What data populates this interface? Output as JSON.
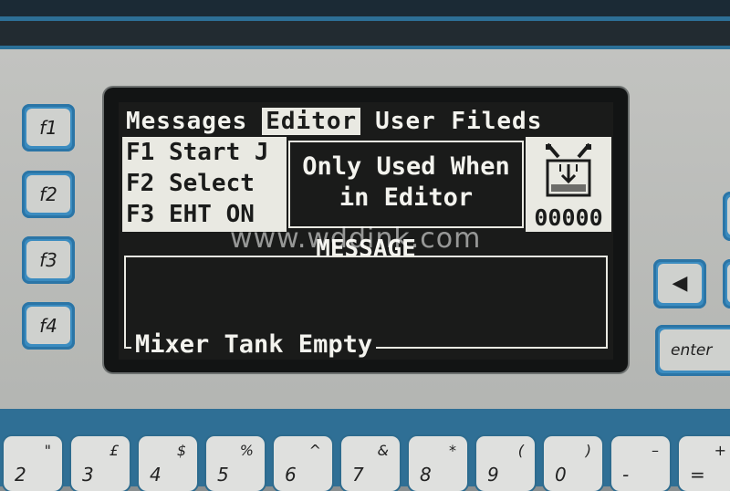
{
  "function_keys": [
    "f1",
    "f2",
    "f3",
    "f4"
  ],
  "screen": {
    "menu": [
      {
        "label": "Messages",
        "selected": false
      },
      {
        "label": "Editor",
        "selected": true
      },
      {
        "label": "User Fileds",
        "selected": false
      }
    ],
    "fkey_items": [
      "F1 Start J",
      "F2 Select",
      "F3 EHT ON"
    ],
    "popup": {
      "line1": "Only Used When",
      "line2": "in Editor"
    },
    "counter": "00000",
    "tank_icon": "ink-tank-icon",
    "message_title": "MESSAGE",
    "message_text": "Mixer Tank Empty"
  },
  "right_keys": {
    "left_arrow": "◀",
    "enter": "enter"
  },
  "number_keys": [
    {
      "num": "2",
      "shift": "\""
    },
    {
      "num": "3",
      "shift": "£"
    },
    {
      "num": "4",
      "shift": "$"
    },
    {
      "num": "5",
      "shift": "%"
    },
    {
      "num": "6",
      "shift": "^"
    },
    {
      "num": "7",
      "shift": "&"
    },
    {
      "num": "8",
      "shift": "*"
    },
    {
      "num": "9",
      "shift": "("
    },
    {
      "num": "0",
      "shift": ")"
    },
    {
      "num": "-",
      "shift": "–"
    },
    {
      "num": "=",
      "shift": "+"
    }
  ],
  "watermark": "www.wddink.com",
  "colors": {
    "lcd_bg": "#1a1b1a",
    "lcd_fg": "#f3f3ee",
    "key_blue": "#3b8cc0"
  }
}
